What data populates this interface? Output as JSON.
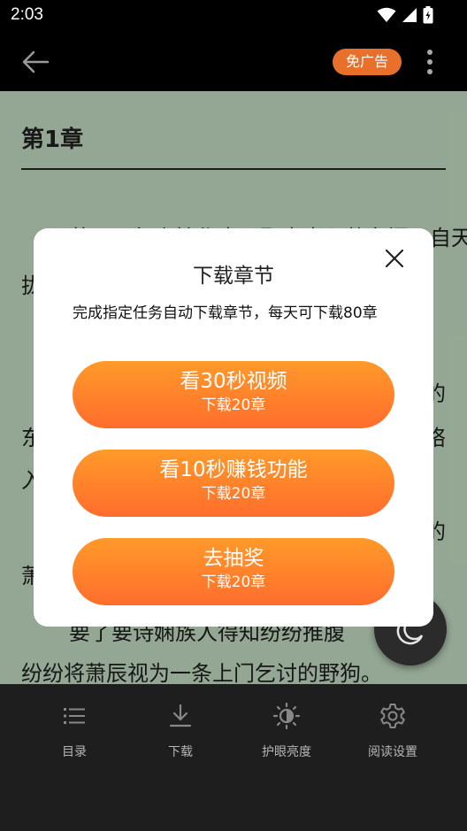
{
  "status_bar": {
    "time": "2:03"
  },
  "app_bar": {
    "ad_free_label": "免广告"
  },
  "reader": {
    "chapter_title": "第1章",
    "text_fragments": [
      "萧辰，年少嫁作夫，娶妻当入赘名门，自天",
      "拢",
      "的",
      "东",
      "络",
      "入",
      "的",
      "萧",
      "要了要诗娴族人得知纷纷推腹",
      "纷纷将萧辰视为一条上门乞讨的野狗。"
    ]
  },
  "dialog": {
    "title": "下载章节",
    "description": "完成指定任务自动下载章节，每天可下载80章",
    "tasks": [
      {
        "label": "看30秒视频",
        "reward": "下载20章"
      },
      {
        "label": "看10秒赚钱功能",
        "reward": "下载20章"
      },
      {
        "label": "去抽奖",
        "reward": "下载20章"
      }
    ]
  },
  "toolbar": {
    "items": [
      {
        "label": "目录",
        "icon": "list-icon"
      },
      {
        "label": "下载",
        "icon": "download-icon"
      },
      {
        "label": "护眼亮度",
        "icon": "brightness-icon"
      },
      {
        "label": "阅读设置",
        "icon": "gear-icon"
      }
    ]
  },
  "colors": {
    "reader_background": "#a9bfa9",
    "accent_orange": "#ff7a2b",
    "ad_badge": "#e8702a",
    "toolbar_background": "#1e1e1e"
  }
}
